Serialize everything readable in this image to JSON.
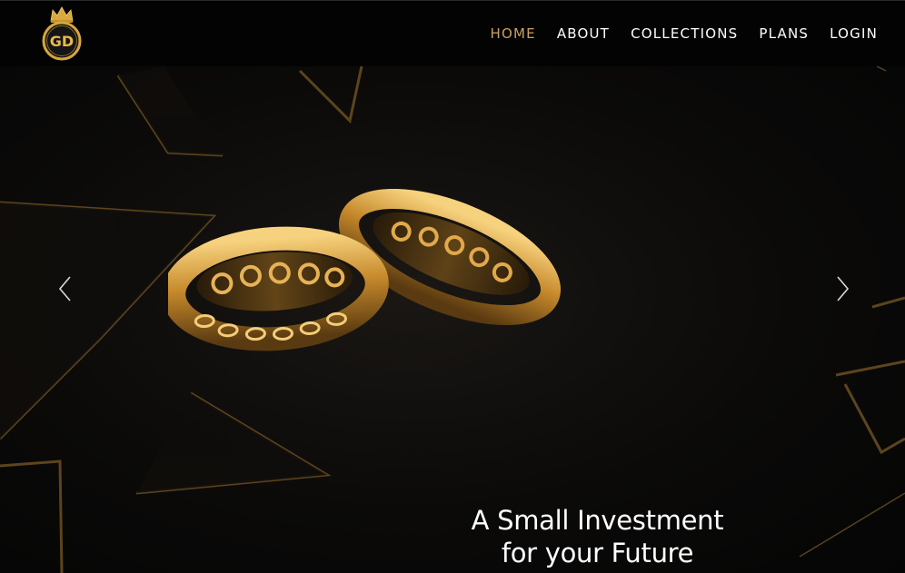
{
  "header": {
    "logo_text": "GD",
    "nav": [
      {
        "label": "HOME",
        "active": true
      },
      {
        "label": "ABOUT",
        "active": false
      },
      {
        "label": "COLLECTIONS",
        "active": false
      },
      {
        "label": "PLANS",
        "active": false
      },
      {
        "label": "LOGIN",
        "active": false
      }
    ]
  },
  "hero": {
    "headline_line1": "A Small Investment",
    "headline_line2": "for your Future",
    "prev_icon": "chevron-left-icon",
    "next_icon": "chevron-right-icon"
  },
  "colors": {
    "accent_gold": "#c9a35e",
    "nav_background": "#030303",
    "text": "#ffffff"
  }
}
